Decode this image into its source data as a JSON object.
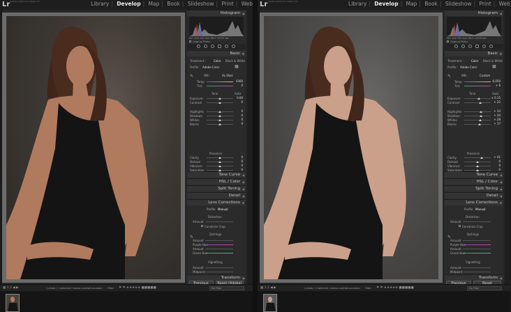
{
  "app": {
    "subtitle": "Adobe Lightroom Classic CC",
    "logo": "Lr"
  },
  "modules": [
    "Library",
    "Develop",
    "Map",
    "Book",
    "Slideshow",
    "Print",
    "Web"
  ],
  "active_module": "Develop",
  "panels": {
    "histogram": "Histogram",
    "original_photo": "Original Photo",
    "basic": "Basic",
    "treatment": "Treatment :",
    "color": "Color",
    "bw": "Black & White",
    "profile": "Profile :",
    "profile_value": "Adobe Color",
    "wb": "WB :",
    "temp": "Temp",
    "tint": "Tint",
    "tone": "Tone",
    "auto": "Auto",
    "exposure": "Exposure",
    "contrast": "Contrast",
    "highlights": "Highlights",
    "shadows": "Shadows",
    "whites": "Whites",
    "blacks": "Blacks",
    "presence": "Presence",
    "clarity": "Clarity",
    "dehaze": "Dehaze",
    "vibrance": "Vibrance",
    "saturation": "Saturation",
    "tone_curve": "Tone Curve",
    "hsl": "HSL / Color",
    "split_toning": "Split Toning",
    "detail": "Detail",
    "lens_corrections": "Lens Corrections",
    "lc_profile": "Profile",
    "lc_manual": "Manual",
    "distortion": "Distortion",
    "amount": "Amount",
    "constrain_crop": "Constrain Crop",
    "defringe": "Defringe",
    "purple_hue": "Purple Hue",
    "green_amount": "Amount",
    "green_hue": "Green Hue",
    "vignetting": "Vignetting",
    "midpoint": "Midpoint",
    "transform": "Transform",
    "previous": "Previous"
  },
  "left": {
    "wb_value": "As Shot",
    "reset_label": "Reset (Adobe)",
    "temp": "4300",
    "tint": "0",
    "exposure": "0.00",
    "contrast": "0",
    "highlights": "0",
    "shadows": "0",
    "whites": "0",
    "blacks": "0",
    "clarity": "0",
    "dehaze": "0",
    "vibrance": "0",
    "saturation": "0",
    "histo_info": "ISO 100   100 mm   f/8.0   1/200 sec",
    "filter_text": "1 photo / 1 selected / donna-cocktail-occasion",
    "filter_label": "Filter :",
    "no_filter": "No Filter",
    "slider_values": {
      "exposure": 0.5,
      "contrast": 0.5,
      "highlights": 0.5,
      "shadows": 0.5,
      "whites": 0.5,
      "blacks": 0.5,
      "clarity": 0.5,
      "dehaze": 0.5,
      "vibrance": 0.5,
      "saturation": 0.5
    }
  },
  "right": {
    "wb_value": "Custom",
    "reset_label": "Reset",
    "temp": "6,050",
    "tint": "+ 6",
    "exposure": "+ 0.15",
    "contrast": "+ 22",
    "highlights": "+ 34",
    "shadows": "+ 34",
    "whites": "+ 28",
    "blacks": "+ 17",
    "clarity": "+ 41",
    "dehaze": "0",
    "vibrance": "0",
    "saturation": "0",
    "histo_info": "ISO 100   100 mm   f/8.0   1/200 sec",
    "filter_text": "1 photo / 1 selected / donna-cocktail-occasion",
    "filter_label": "Filter :",
    "no_filter": "No Filter",
    "slider_values": {
      "exposure": 0.55,
      "contrast": 0.6,
      "highlights": 0.62,
      "shadows": 0.62,
      "whites": 0.6,
      "blacks": 0.58,
      "clarity": 0.66,
      "dehaze": 0.5,
      "vibrance": 0.5,
      "saturation": 0.5
    }
  }
}
